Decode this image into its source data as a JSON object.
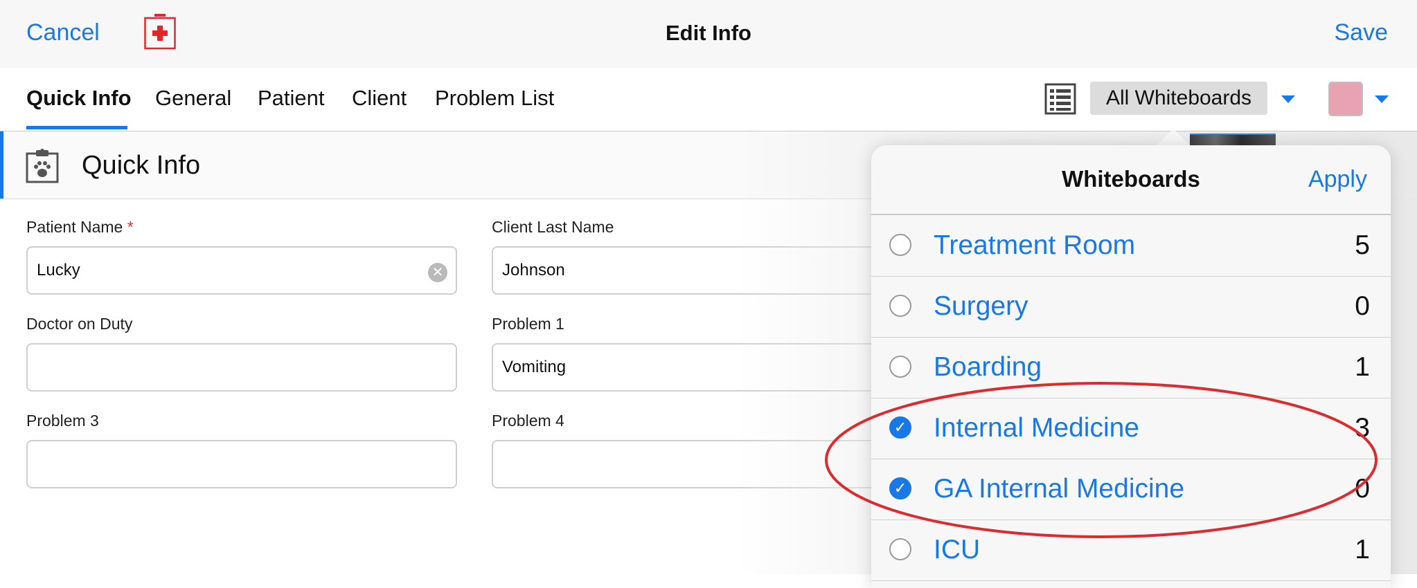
{
  "navbar": {
    "cancel_label": "Cancel",
    "title": "Edit Info",
    "save_label": "Save",
    "logo_icon": "medical-kit-icon",
    "accent_color": "#1878e8"
  },
  "tabs": [
    {
      "label": "Quick Info",
      "active": true
    },
    {
      "label": "General",
      "active": false
    },
    {
      "label": "Patient",
      "active": false
    },
    {
      "label": "Client",
      "active": false
    },
    {
      "label": "Problem List",
      "active": false
    }
  ],
  "toolbar": {
    "list_icon": "list-icon",
    "whiteboard_selected": "All Whiteboards",
    "swatch_color": "#e9a2b2"
  },
  "section": {
    "title": "Quick Info",
    "icon": "clipboard-paw-icon"
  },
  "form": {
    "patient_name_label": "Patient Name",
    "patient_name_required": "*",
    "patient_name_value": "Lucky",
    "client_last_name_label": "Client Last Name",
    "client_last_name_value": "Johnson",
    "doctor_on_duty_label": "Doctor on Duty",
    "doctor_on_duty_value": "",
    "problem1_label": "Problem 1",
    "problem1_value": "Vomiting",
    "problem3_label": "Problem 3",
    "problem3_value": "",
    "problem4_label": "Problem 4",
    "problem4_value": ""
  },
  "popover": {
    "title": "Whiteboards",
    "apply_label": "Apply",
    "items": [
      {
        "label": "Treatment Room",
        "count": "5",
        "checked": false
      },
      {
        "label": "Surgery",
        "count": "0",
        "checked": false
      },
      {
        "label": "Boarding",
        "count": "1",
        "checked": false
      },
      {
        "label": "Internal Medicine",
        "count": "3",
        "checked": true
      },
      {
        "label": "GA Internal Medicine",
        "count": "0",
        "checked": true
      },
      {
        "label": "ICU",
        "count": "1",
        "checked": false
      }
    ]
  }
}
